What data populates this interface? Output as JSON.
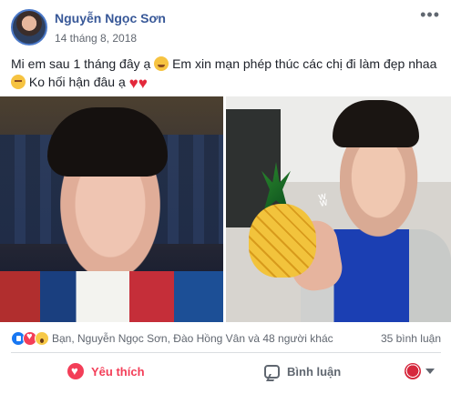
{
  "post": {
    "author": "Nguyễn Ngọc Sơn",
    "timestamp": "14 tháng 8, 2018",
    "more_icon": "more-options-icon",
    "text_line1": "Mi em sau 1 tháng đây ạ",
    "text_line1_suffix": "Em xin mạn phép thúc các chị đi làm đẹp nhaa",
    "text_line2": "Ko hối hận đâu ạ",
    "emoji_icons": [
      "winking-face-icon",
      "relieved-face-icon",
      "heart-icon",
      "heart-icon"
    ]
  },
  "photos": {
    "left_alt": "",
    "right_alt": ""
  },
  "reactions": {
    "icons": [
      "like-icon",
      "love-icon",
      "wow-icon"
    ],
    "summary": "Bạn, Nguyễn Ngọc Sơn, Đào Hồng Vân và 48 người khác",
    "comments": "35 bình luận"
  },
  "actions": {
    "love_label": "Yêu thích",
    "comment_label": "Bình luận",
    "share_menu_icon": "chevron-down-icon"
  },
  "colors": {
    "author_name": "#385898",
    "love_action": "#f33e58",
    "like_reaction": "#1877f2",
    "wow_reaction": "#f7c948"
  }
}
